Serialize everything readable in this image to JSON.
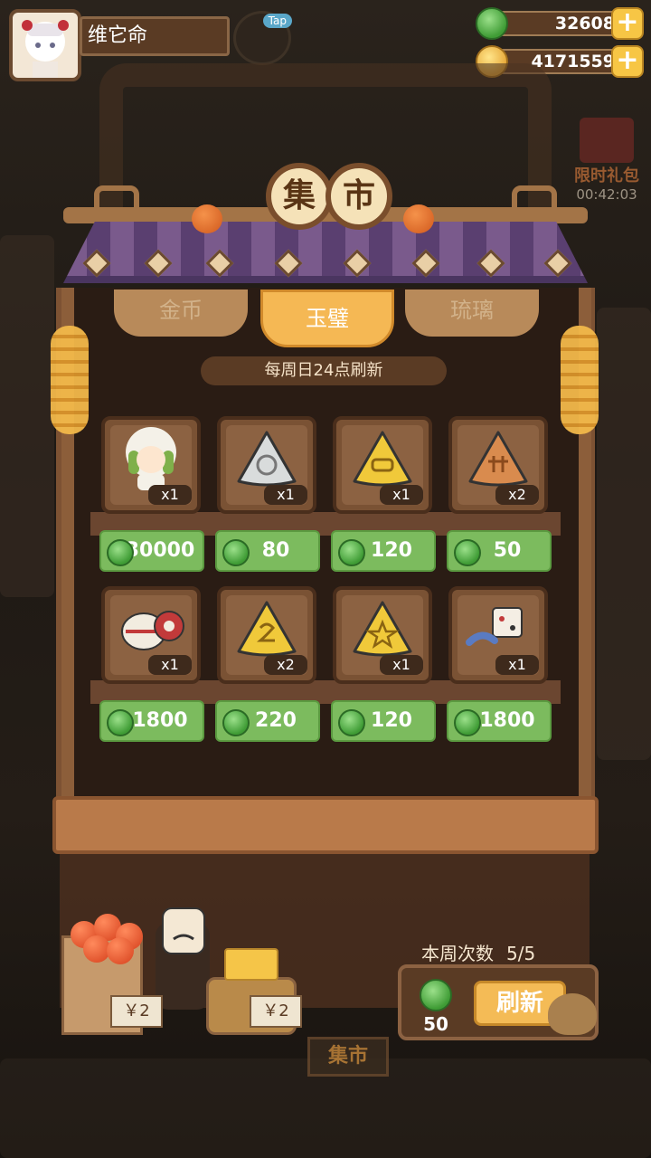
{
  "player": {
    "name": "维它命"
  },
  "tap_badge": "Tap",
  "resources": {
    "jade": "32608",
    "coins": "4171559"
  },
  "gift": {
    "label": "限时礼包",
    "timer": "00:42:03"
  },
  "market": {
    "title_chars": [
      "集",
      "市"
    ],
    "tabs": [
      "金币",
      "玉璧",
      "琉璃"
    ],
    "active_tab": "玉璧",
    "refresh_note": "每周日24点刷新",
    "items": [
      {
        "icon": "doll-icon",
        "count": "x1",
        "price": "30000"
      },
      {
        "icon": "silver-token-icon",
        "count": "x1",
        "price": "80"
      },
      {
        "icon": "gold-token-icon",
        "count": "x1",
        "price": "120"
      },
      {
        "icon": "bronze-token-icon",
        "count": "x2",
        "price": "50"
      },
      {
        "icon": "porcelain-jar-icon",
        "count": "x1",
        "price": "1800"
      },
      {
        "icon": "gold-token-icon",
        "count": "x2",
        "price": "220"
      },
      {
        "icon": "gold-star-token-icon",
        "count": "x1",
        "price": "120"
      },
      {
        "icon": "dice-toy-icon",
        "count": "x1",
        "price": "1800"
      }
    ],
    "weekly_label": "本周次数",
    "weekly_count": "5/5",
    "refresh_cost": "50",
    "refresh_button": "刷新"
  },
  "stall": {
    "price_tag_1": "￥2",
    "price_tag_2": "￥2",
    "shop_sign": "集市"
  },
  "colors": {
    "jade_green": "#7cbb5e",
    "accent_gold": "#f4bb56",
    "wood": "#8c5e3a"
  }
}
